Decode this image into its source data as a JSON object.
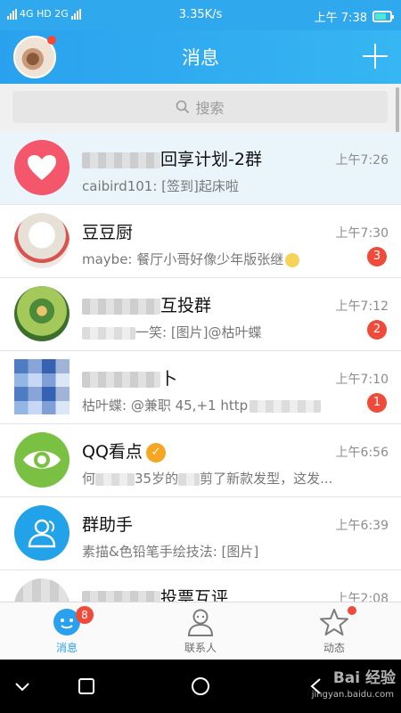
{
  "status_bar": {
    "left_text": "4G HD 2G",
    "speed": "3.35K/s",
    "time": "上午 7:38"
  },
  "header": {
    "title": "消息",
    "profile_has_notification": true
  },
  "search": {
    "placeholder": "搜索"
  },
  "conversations": [
    {
      "name_suffix": "回享计划-2群",
      "name_obscured": true,
      "message": "caibird101: [签到]起床啦",
      "time": "上午7:26",
      "badge": "",
      "pinned": true,
      "avatar": "heart-icon"
    },
    {
      "name": "豆豆厨",
      "message": "maybe: 餐厅小哥好像少年版张继",
      "time": "上午7:30",
      "badge": "3",
      "avatar": "dog-photo"
    },
    {
      "name_suffix": "互投群",
      "name_obscured": true,
      "message_suffix": "一笑: [图片]@枯叶蝶",
      "time": "上午7:12",
      "badge": "2",
      "avatar": "yoga-photo"
    },
    {
      "name_suffix": "卜",
      "name_obscured": true,
      "message": "枯叶蝶: @兼职 45,+1 http",
      "time": "上午7:10",
      "badge": "1",
      "avatar": "mosaic-photo"
    },
    {
      "name": "QQ看点",
      "verified": true,
      "message_prefix": "何",
      "message_suffix": "35岁的",
      "message_tail": "剪了新款发型，这发...",
      "time": "上午6:56",
      "badge": "",
      "avatar": "eye-icon"
    },
    {
      "name": "群助手",
      "message": "素描&色铅笔手绘技法: [图片]",
      "time": "上午6:39",
      "badge": "",
      "avatar": "group-helper-icon"
    },
    {
      "name_suffix": "投票互评",
      "name_obscured": true,
      "message": "",
      "time": "上午2:08",
      "badge": "",
      "avatar": "obscured-photo"
    }
  ],
  "tabs": [
    {
      "label": "消息",
      "badge": "8",
      "active": true
    },
    {
      "label": "联系人",
      "badge": "",
      "active": false
    },
    {
      "label": "动态",
      "badge": "",
      "dot": true,
      "active": false
    }
  ],
  "watermark": {
    "text": "Bai 经验",
    "url": "jingyan.baidu.com"
  },
  "colors": {
    "header_blue": "#2aa1ee",
    "badge_red": "#f04a3a",
    "pinned_row_bg": "#e9f5fb"
  }
}
